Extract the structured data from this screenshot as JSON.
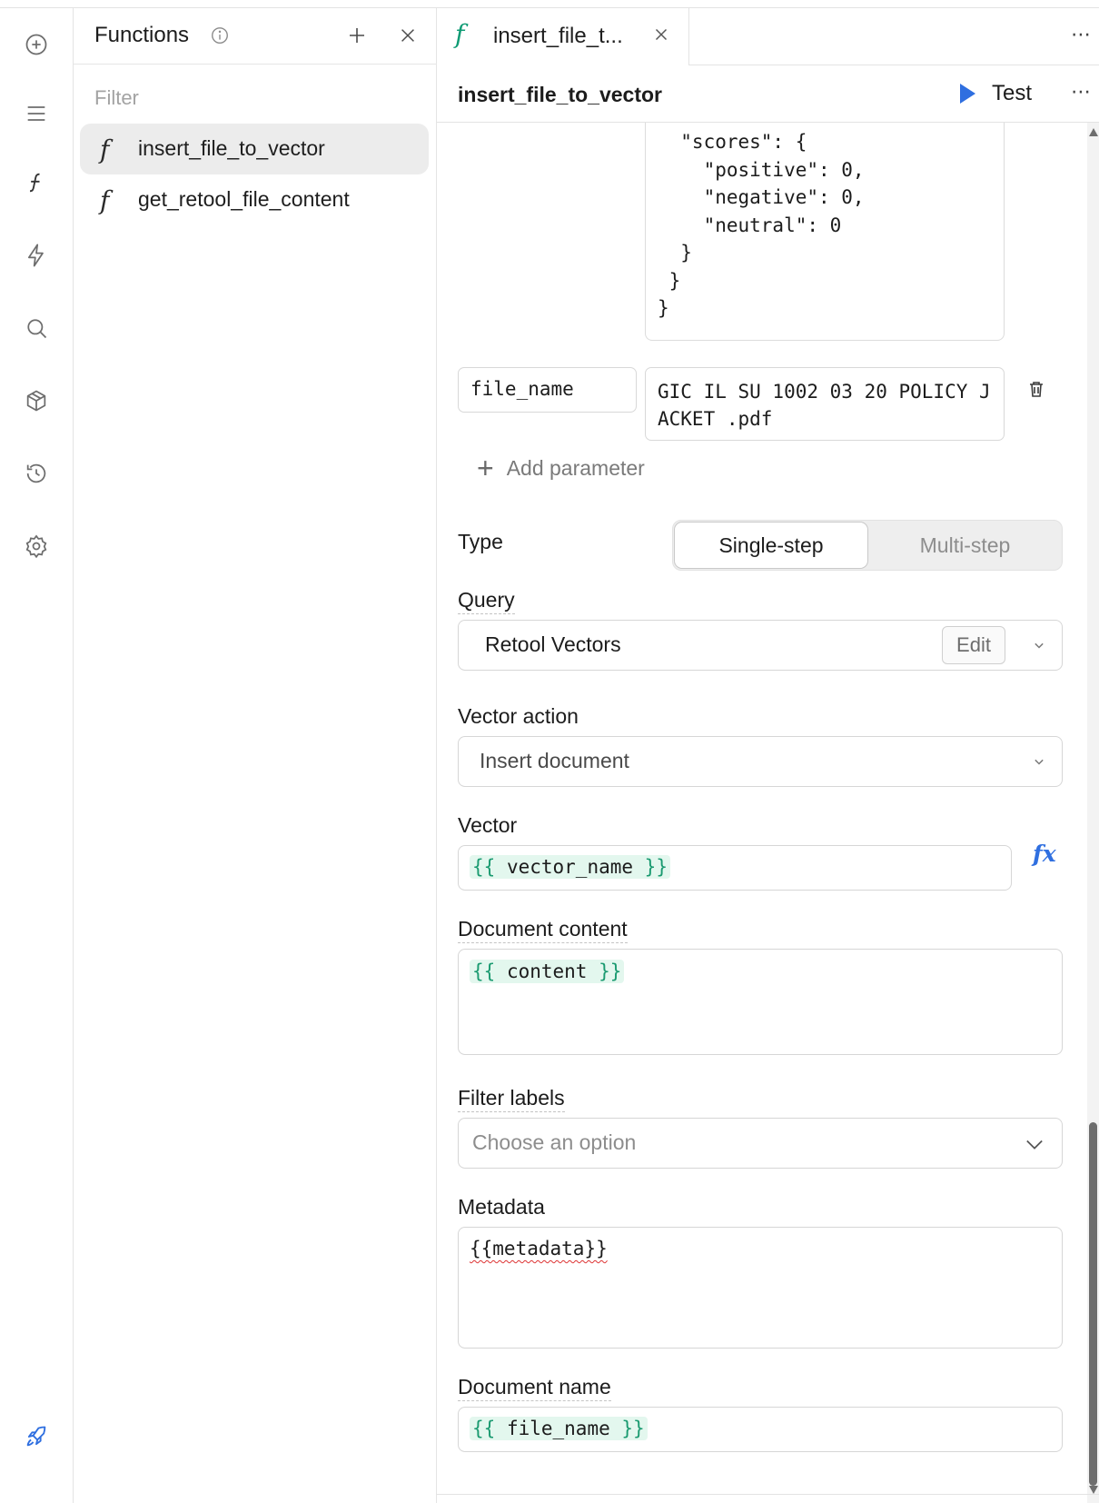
{
  "functions_panel": {
    "title": "Functions",
    "filter_placeholder": "Filter",
    "items": [
      {
        "icon": "function-icon",
        "label": "insert_file_to_vector",
        "active": true
      },
      {
        "icon": "function-icon",
        "label": "get_retool_file_content",
        "active": false
      }
    ]
  },
  "rail": {
    "icons": [
      "add-circle-icon",
      "menu-icon",
      "function-icon",
      "lightning-icon",
      "search-icon",
      "cube-icon",
      "history-icon",
      "settings-icon",
      "rocket-icon"
    ]
  },
  "tab": {
    "label": "insert_file_t...",
    "icon": "function-icon"
  },
  "header": {
    "title": "insert_file_to_vector",
    "test_label": "Test",
    "more": "⋯"
  },
  "json_preview": "  \"scores\": {\n    \"positive\": 0,\n    \"negative\": 0,\n    \"neutral\": 0\n  }\n }\n}",
  "parameter": {
    "key": "file_name",
    "value": "GIC IL SU 1002 03 20 POLICY JACKET .pdf"
  },
  "add_parameter_label": "Add parameter",
  "type": {
    "label": "Type",
    "options": [
      "Single-step",
      "Multi-step"
    ],
    "selected": "Single-step"
  },
  "query": {
    "label": "Query",
    "value": "Retool Vectors",
    "edit_label": "Edit"
  },
  "vector_action": {
    "label": "Vector action",
    "value": "Insert document"
  },
  "vector": {
    "label": "Vector",
    "open": "{{",
    "expr": " vector_name ",
    "close": "}}",
    "fx_label": "fx"
  },
  "document_content": {
    "label": "Document content",
    "open": "{{",
    "expr": " content ",
    "close": "}}"
  },
  "filter_labels": {
    "label": "Filter labels",
    "placeholder": "Choose an option"
  },
  "metadata": {
    "label": "Metadata",
    "value": "{{metadata}}"
  },
  "document_name": {
    "label": "Document name",
    "open": "{{",
    "expr": " file_name ",
    "close": "}}"
  },
  "colors": {
    "accent_blue": "#2f6fe0",
    "function_green": "#0f9b74",
    "token_bg": "#e3f7ee",
    "token_fg": "#1a9a70"
  }
}
